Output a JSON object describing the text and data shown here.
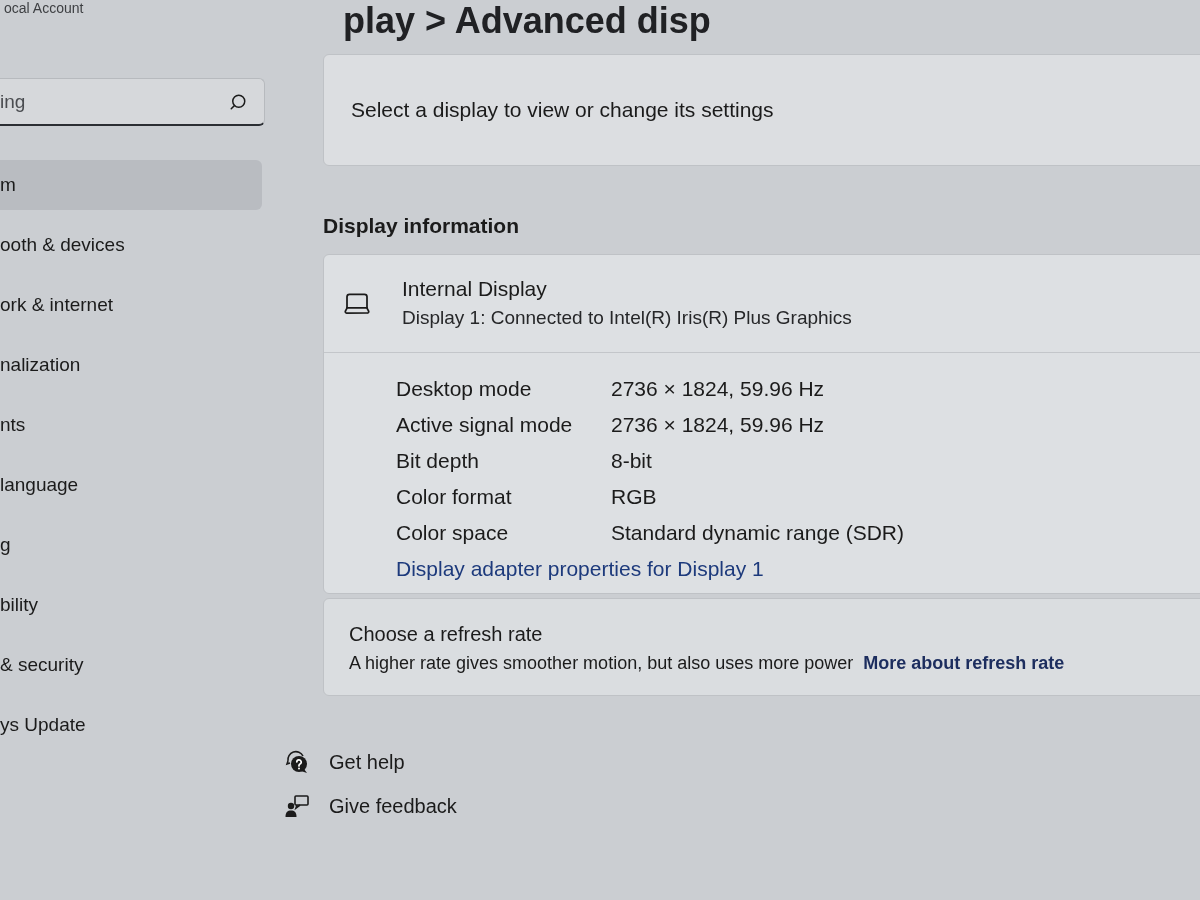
{
  "account": {
    "label": "ocal Account"
  },
  "search": {
    "placeholder": "ing"
  },
  "sidebar": {
    "items": [
      {
        "label": "m",
        "selected": true
      },
      {
        "label": "ooth & devices",
        "selected": false
      },
      {
        "label": "ork & internet",
        "selected": false
      },
      {
        "label": "nalization",
        "selected": false
      },
      {
        "label": "nts",
        "selected": false
      },
      {
        "label": "language",
        "selected": false
      },
      {
        "label": "g",
        "selected": false
      },
      {
        "label": "bility",
        "selected": false
      },
      {
        "label": "& security",
        "selected": false
      },
      {
        "label": "ys Update",
        "selected": false
      }
    ]
  },
  "page_title": "play > Advanced disp",
  "display_select": {
    "label": "Select a display to view or change its settings"
  },
  "display_information": {
    "heading": "Display information",
    "display": {
      "name": "Internal Display",
      "connection": "Display 1: Connected to Intel(R) Iris(R) Plus Graphics"
    },
    "properties": [
      {
        "label": "Desktop mode",
        "value": "2736 × 1824, 59.96 Hz"
      },
      {
        "label": "Active signal mode",
        "value": "2736 × 1824, 59.96 Hz"
      },
      {
        "label": "Bit depth",
        "value": "8-bit"
      },
      {
        "label": "Color format",
        "value": "RGB"
      },
      {
        "label": "Color space",
        "value": "Standard dynamic range (SDR)"
      }
    ],
    "adapter_link": "Display adapter properties for Display 1"
  },
  "refresh_rate": {
    "title": "Choose a refresh rate",
    "description": "A higher rate gives smoother motion, but also uses more power",
    "link": "More about refresh rate"
  },
  "help_links": [
    {
      "kind": "help",
      "label": "Get help"
    },
    {
      "kind": "feedback",
      "label": "Give feedback"
    }
  ]
}
